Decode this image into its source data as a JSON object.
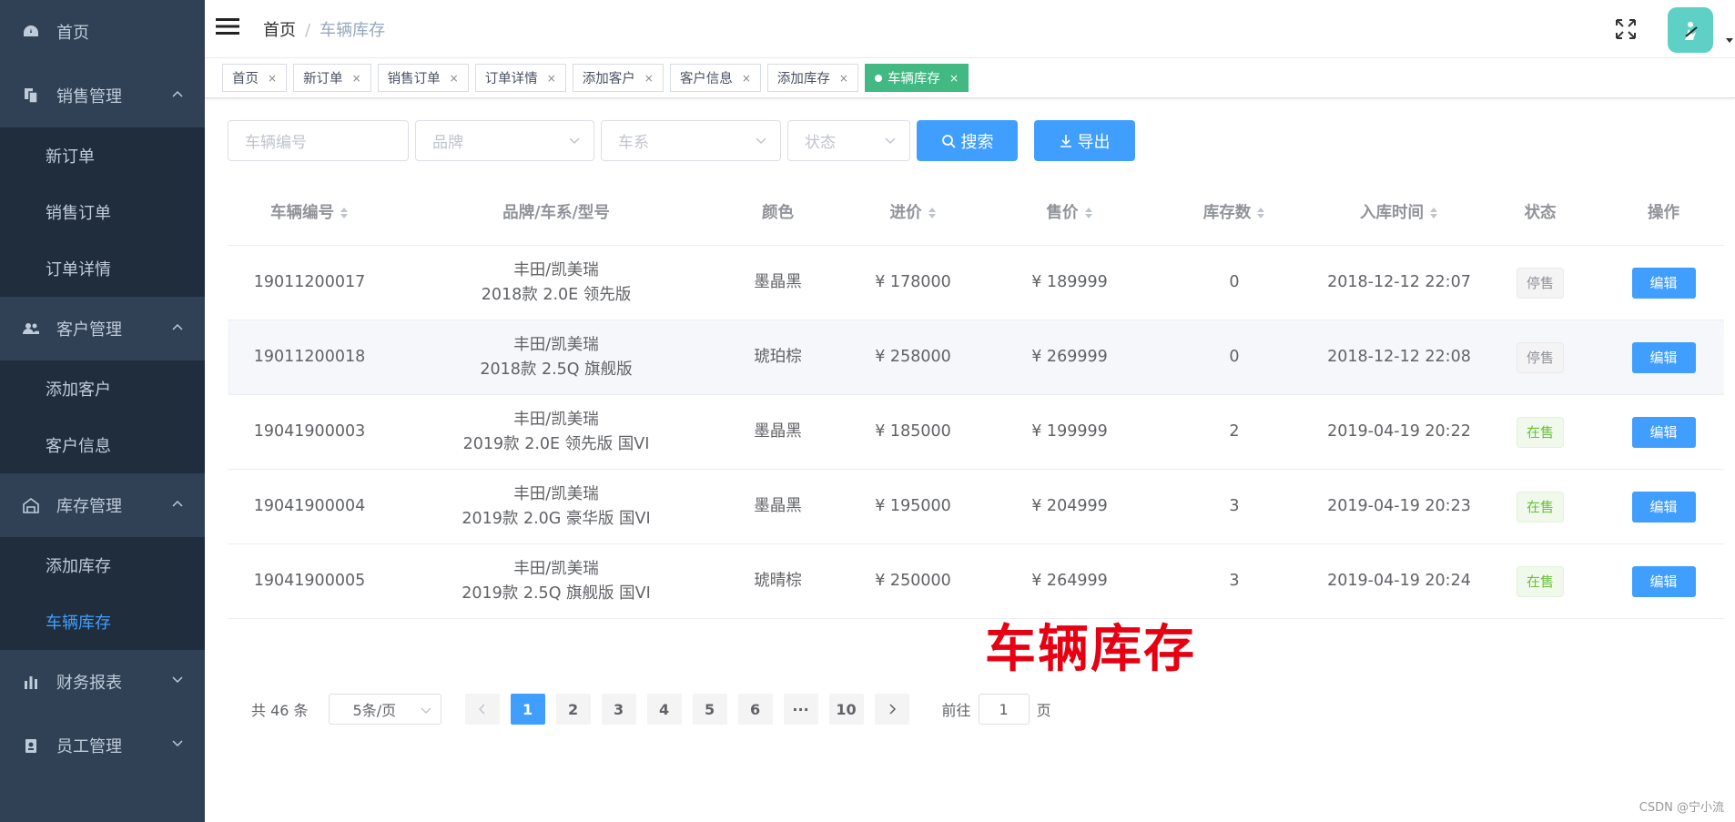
{
  "sidebar": {
    "home": "首页",
    "sales": "销售管理",
    "sales_items": [
      "新订单",
      "销售订单",
      "订单详情"
    ],
    "customers": "客户管理",
    "customer_items": [
      "添加客户",
      "客户信息"
    ],
    "inventory": "库存管理",
    "inventory_items": [
      "添加库存",
      "车辆库存"
    ],
    "finance": "财务报表",
    "staff": "员工管理"
  },
  "header": {
    "breadcrumb_home": "首页",
    "breadcrumb_sep": "/",
    "breadcrumb_current": "车辆库存"
  },
  "tags": [
    {
      "label": "首页"
    },
    {
      "label": "新订单"
    },
    {
      "label": "销售订单"
    },
    {
      "label": "订单详情"
    },
    {
      "label": "添加客户"
    },
    {
      "label": "客户信息"
    },
    {
      "label": "添加库存"
    },
    {
      "label": "车辆库存",
      "active": true
    }
  ],
  "tag_close": "×",
  "filter": {
    "vehicle_no_placeholder": "车辆编号",
    "brand_placeholder": "品牌",
    "series_placeholder": "车系",
    "status_placeholder": "状态",
    "search_label": "搜索",
    "export_label": "导出"
  },
  "table": {
    "headers": [
      "车辆编号",
      "品牌/车系/型号",
      "颜色",
      "进价",
      "售价",
      "库存数",
      "入库时间",
      "状态",
      "操作"
    ],
    "rows": [
      {
        "id": "19011200017",
        "model1": "丰田/凯美瑞",
        "model2": "2018款 2.0E 领先版",
        "color": "墨晶黑",
        "cost": "¥ 178000",
        "price": "¥ 189999",
        "stock": "0",
        "time": "2018-12-12 22:07",
        "status": "停售",
        "on_sale": false,
        "action": "编辑"
      },
      {
        "id": "19011200018",
        "model1": "丰田/凯美瑞",
        "model2": "2018款 2.5Q 旗舰版",
        "color": "琥珀棕",
        "cost": "¥ 258000",
        "price": "¥ 269999",
        "stock": "0",
        "time": "2018-12-12 22:08",
        "status": "停售",
        "on_sale": false,
        "action": "编辑"
      },
      {
        "id": "19041900003",
        "model1": "丰田/凯美瑞",
        "model2": "2019款 2.0E 领先版 国VI",
        "color": "墨晶黑",
        "cost": "¥ 185000",
        "price": "¥ 199999",
        "stock": "2",
        "time": "2019-04-19 20:22",
        "status": "在售",
        "on_sale": true,
        "action": "编辑"
      },
      {
        "id": "19041900004",
        "model1": "丰田/凯美瑞",
        "model2": "2019款 2.0G 豪华版 国VI",
        "color": "墨晶黑",
        "cost": "¥ 195000",
        "price": "¥ 204999",
        "stock": "3",
        "time": "2019-04-19 20:23",
        "status": "在售",
        "on_sale": true,
        "action": "编辑"
      },
      {
        "id": "19041900005",
        "model1": "丰田/凯美瑞",
        "model2": "2019款 2.5Q 旗舰版 国VI",
        "color": "琥晴棕",
        "cost": "¥ 250000",
        "price": "¥ 264999",
        "stock": "3",
        "time": "2019-04-19 20:24",
        "status": "在售",
        "on_sale": true,
        "action": "编辑"
      }
    ]
  },
  "watermark": "车辆库存",
  "pagination": {
    "total": "共 46 条",
    "page_size": "5条/页",
    "pages": [
      "1",
      "2",
      "3",
      "4",
      "5",
      "6",
      "···",
      "10"
    ],
    "current": "1",
    "goto_prefix": "前往",
    "goto_value": "1",
    "goto_suffix": "页"
  },
  "footer_credit": "CSDN @宁小流",
  "colors": {
    "sidebar_bg": "#304156",
    "submenu_bg": "#1f2d3d",
    "primary": "#409eff",
    "active_tag": "#42b983"
  }
}
